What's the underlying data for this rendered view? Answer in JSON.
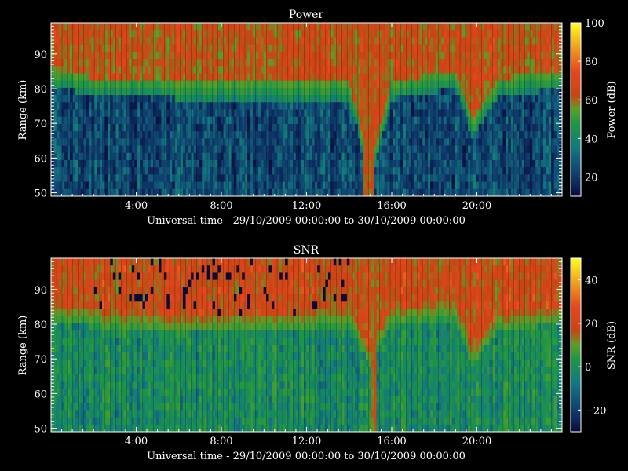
{
  "figure": {
    "background": "#000000",
    "foreground": "#ffffff"
  },
  "chart_data": [
    {
      "type": "heatmap",
      "title": "Power",
      "xlabel": "Universal time - 29/10/2009 00:00:00 to 30/10/2009 00:00:00",
      "ylabel": "Range (km)",
      "xlim": [
        0,
        24
      ],
      "ylim": [
        49,
        99
      ],
      "x_ticks": [
        4,
        8,
        12,
        16,
        20
      ],
      "x_tick_labels": [
        "4:00",
        "8:00",
        "12:00",
        "16:00",
        "20:00"
      ],
      "y_ticks": [
        50,
        60,
        70,
        80,
        90
      ],
      "y_tick_labels": [
        "50",
        "60",
        "70",
        "80",
        "90"
      ],
      "colorbar": {
        "label": "Power (dB)",
        "range": [
          10,
          100
        ],
        "ticks": [
          20,
          40,
          60,
          80,
          100
        ],
        "tick_labels": [
          "20",
          "40",
          "60",
          "80",
          "100"
        ]
      },
      "colormap": [
        "#0a0a3c",
        "#0f3c6e",
        "#147882",
        "#1e9646",
        "#5aa028",
        "#c84614",
        "#e6461e",
        "#f0a01e",
        "#ffff1e"
      ],
      "structure": {
        "boundary_km": [
          [
            0,
            83
          ],
          [
            2,
            80
          ],
          [
            4,
            80
          ],
          [
            6,
            79
          ],
          [
            10,
            79
          ],
          [
            14,
            79
          ],
          [
            15,
            55
          ],
          [
            16,
            79
          ],
          [
            19,
            82
          ],
          [
            19.8,
            68
          ],
          [
            21,
            80
          ],
          [
            24,
            82
          ]
        ],
        "top_level_db": 66,
        "bottom_level_db": 22,
        "vertical_stripe_hours": [
          14.7,
          15.2
        ]
      }
    },
    {
      "type": "heatmap",
      "title": "SNR",
      "xlabel": "Universal time - 29/10/2009 00:00:00 to 30/10/2009 00:00:00",
      "ylabel": "Range (km)",
      "xlim": [
        0,
        24
      ],
      "ylim": [
        49,
        99
      ],
      "x_ticks": [
        4,
        8,
        12,
        16,
        20
      ],
      "x_tick_labels": [
        "4:00",
        "8:00",
        "12:00",
        "16:00",
        "20:00"
      ],
      "y_ticks": [
        50,
        60,
        70,
        80,
        90
      ],
      "y_tick_labels": [
        "50",
        "60",
        "70",
        "80",
        "90"
      ],
      "colorbar": {
        "label": "SNR (dB)",
        "range": [
          -30,
          50
        ],
        "ticks": [
          -20,
          0,
          20,
          40
        ],
        "tick_labels": [
          "−20",
          "0",
          "20",
          "40"
        ]
      },
      "colormap": [
        "#0a0a3c",
        "#0f3c6e",
        "#147882",
        "#1e9646",
        "#5aa028",
        "#c84614",
        "#e6461e",
        "#f0a01e",
        "#ffff1e"
      ],
      "structure": {
        "boundary_km": [
          [
            0,
            83
          ],
          [
            2,
            81
          ],
          [
            4,
            80
          ],
          [
            6,
            79
          ],
          [
            10,
            80
          ],
          [
            14,
            81
          ],
          [
            15,
            70
          ],
          [
            16,
            82
          ],
          [
            19,
            83
          ],
          [
            19.8,
            70
          ],
          [
            21,
            80
          ],
          [
            24,
            82
          ]
        ],
        "top_level_db": 22,
        "bottom_level_db": -5,
        "vertical_stripe_hours": [
          15.0,
          15.3
        ]
      }
    }
  ]
}
